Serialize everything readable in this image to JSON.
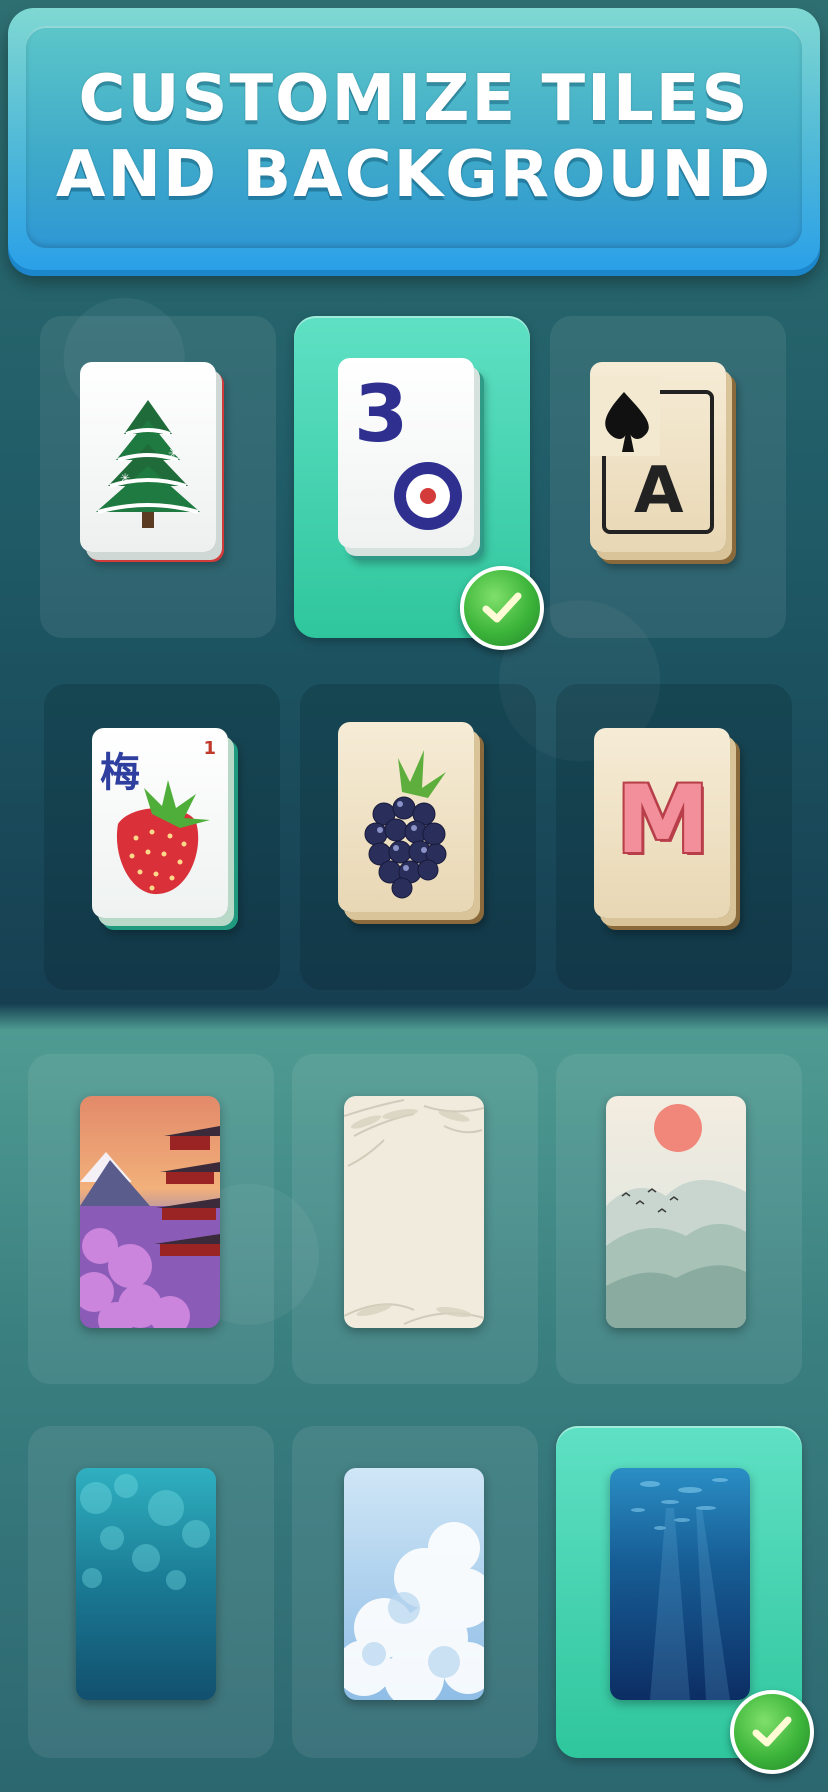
{
  "banner": {
    "line1": "CUSTOMIZE TILES",
    "line2": "AND BACKGROUND"
  },
  "tiles": {
    "items": [
      {
        "name": "winter-pine",
        "icon": "pine-tree-icon",
        "selected": false
      },
      {
        "name": "number-three-circle",
        "glyph": "3",
        "icon": "circle-dot-icon",
        "selected": true
      },
      {
        "name": "ace-of-spades",
        "glyph": "A",
        "icon": "spade-icon",
        "selected": false
      },
      {
        "name": "plum-strawberry",
        "glyph": "梅",
        "corner": "1",
        "icon": "strawberry-icon",
        "selected": false
      },
      {
        "name": "blackberry",
        "icon": "blackberry-icon",
        "selected": false
      },
      {
        "name": "letter-m",
        "glyph": "M",
        "selected": false
      }
    ]
  },
  "backgrounds": {
    "items": [
      {
        "name": "sakura-pagoda",
        "selected": false
      },
      {
        "name": "bamboo-paper",
        "selected": false
      },
      {
        "name": "misty-mountains",
        "selected": false
      },
      {
        "name": "teal-bokeh",
        "selected": false
      },
      {
        "name": "sky-clouds",
        "selected": false
      },
      {
        "name": "underwater",
        "selected": true
      }
    ]
  },
  "colors": {
    "selected_panel": "#3fd2ad",
    "check_green": "#3cb43a",
    "banner_blue": "#2aa0e8"
  }
}
